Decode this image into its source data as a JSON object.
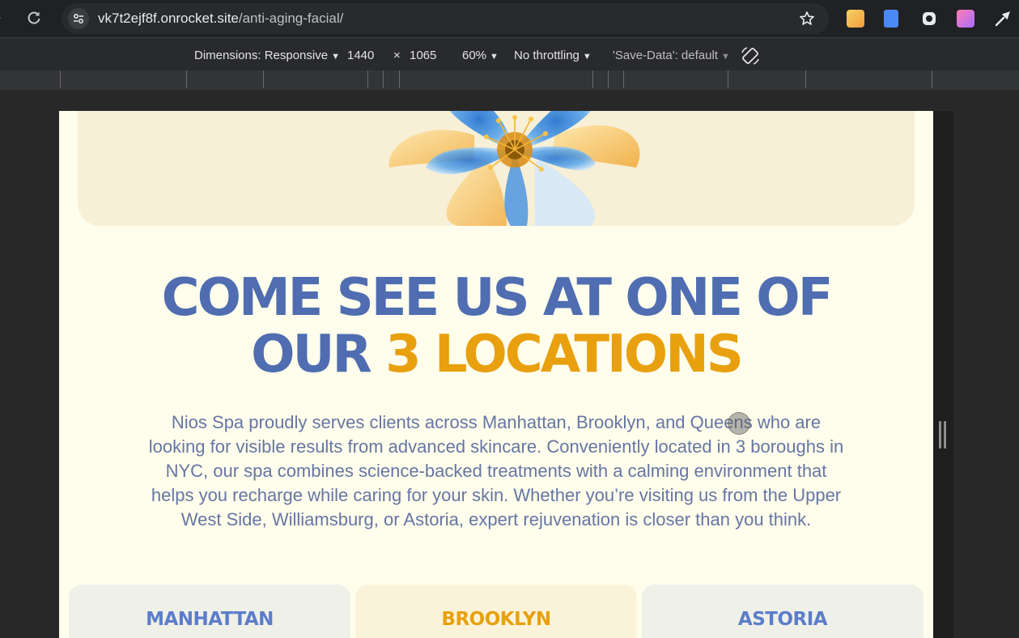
{
  "browser": {
    "url_host": "vk7t2ejf8f.onrocket.site",
    "url_path": "/anti-aging-facial/"
  },
  "devtools": {
    "dimensions_label": "Dimensions: Responsive",
    "width": "1440",
    "times": "×",
    "height": "1065",
    "zoom": "60%",
    "throttling": "No throttling",
    "save_data": "'Save-Data': default"
  },
  "page": {
    "headline_line1": "COME SEE US AT ONE OF",
    "headline_line2_prefix": "OUR ",
    "headline_line2_accent": "3 LOCATIONS",
    "intro": "Nios Spa proudly serves clients across Manhattan, Brooklyn, and Queens who are looking for visible results from advanced skincare. Conveniently located in 3 boroughs in NYC, our spa combines science-backed treatments with a calming environment that helps you recharge while caring for your skin. Whether you’re visiting us from the Upper West Side, Williamsburg, or Astoria, expert rejuvenation is closer than you think.",
    "locations": [
      {
        "name": "MANHATTAN"
      },
      {
        "name": "BROOKLYN"
      },
      {
        "name": "ASTORIA"
      }
    ]
  },
  "colors": {
    "headline_blue": "#4f6db0",
    "accent_orange": "#e8a00e",
    "page_bg": "#fffdec",
    "hero_bg": "#f7efd6"
  }
}
